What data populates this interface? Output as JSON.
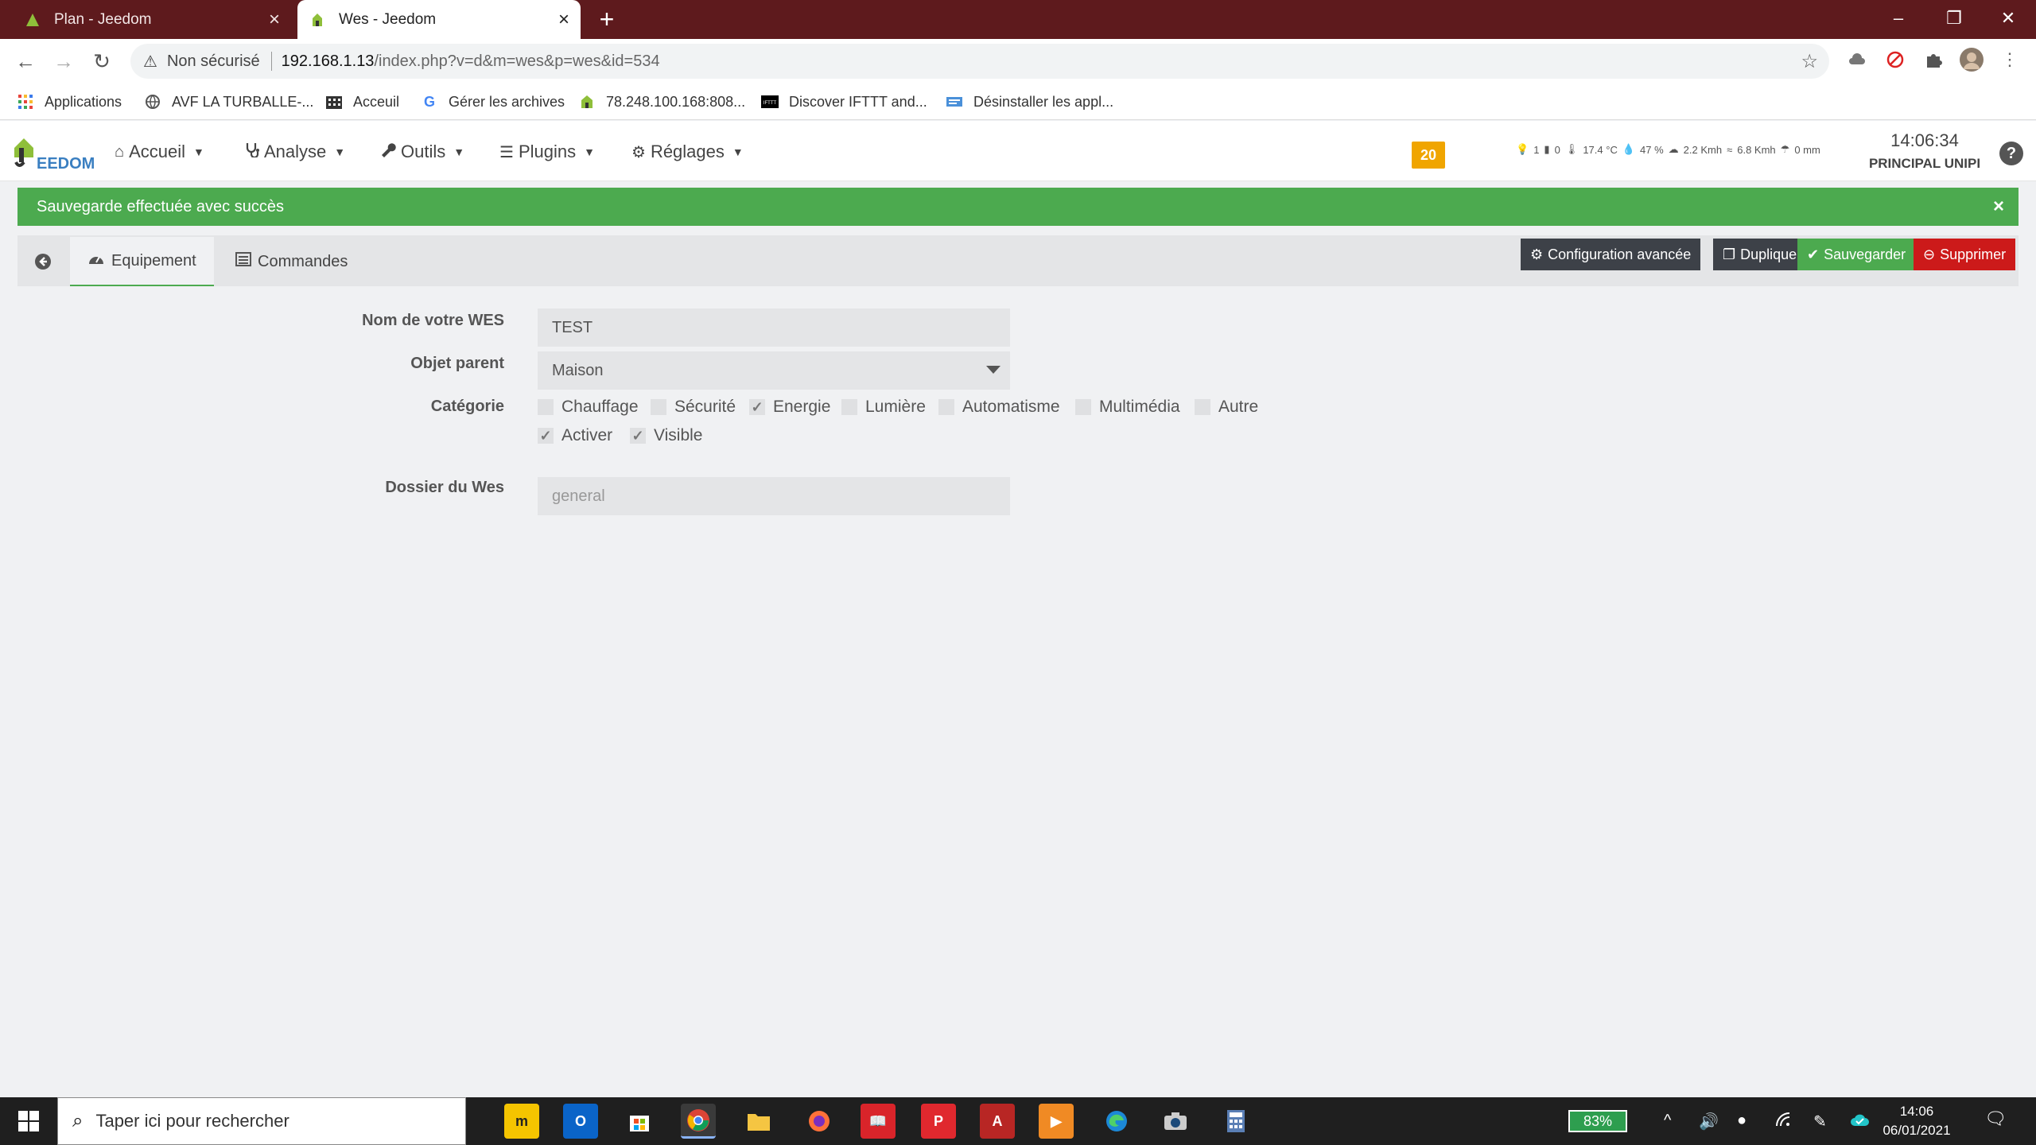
{
  "browser": {
    "tabs": [
      {
        "title": "Plan - Jeedom",
        "active": false
      },
      {
        "title": "Wes - Jeedom",
        "active": true
      }
    ],
    "url_security": "Non sécurisé",
    "url_host": "192.168.1.13",
    "url_path": "/index.php?v=d&m=wes&p=wes&id=534",
    "bookmarks": [
      {
        "label": "Applications",
        "icon": "apps-grid-icon"
      },
      {
        "label": "AVF LA TURBALLE-...",
        "icon": "globe-icon"
      },
      {
        "label": "Acceuil",
        "icon": "building-icon"
      },
      {
        "label": "Gérer les archives",
        "icon": "google-icon"
      },
      {
        "label": "78.248.100.168:808...",
        "icon": "jeedom-icon"
      },
      {
        "label": "Discover IFTTT and...",
        "icon": "ifttt-icon"
      },
      {
        "label": "Désinstaller les appl...",
        "icon": "uninstall-icon"
      }
    ]
  },
  "jeedom": {
    "menu": [
      {
        "label": "Accueil",
        "icon": "home-icon"
      },
      {
        "label": "Analyse",
        "icon": "stethoscope-icon"
      },
      {
        "label": "Outils",
        "icon": "wrench-icon"
      },
      {
        "label": "Plugins",
        "icon": "list-icon"
      },
      {
        "label": "Réglages",
        "icon": "gear-icon"
      }
    ],
    "notification_count": "20",
    "weather": {
      "lights": "1",
      "doors": "0",
      "temperature": "17.4 °C",
      "humidity": "47 %",
      "wind": "2.2 Kmh",
      "gust": "6.8 Kmh",
      "rain": "0 mm"
    },
    "time": "14:06:34",
    "hostname": "PRINCIPAL UNIPI"
  },
  "alert": {
    "message": "Sauvegarde effectuée avec succès",
    "close": "×"
  },
  "panel": {
    "tabs": {
      "equipment": "Equipement",
      "commands": "Commandes"
    },
    "actions": {
      "advanced": "Configuration avancée",
      "duplicate": "Dupliquer",
      "save": "Sauvegarder",
      "delete": "Supprimer"
    },
    "form": {
      "name_label": "Nom de votre WES",
      "name_value": "TEST",
      "parent_label": "Objet parent",
      "parent_value": "Maison",
      "category_label": "Catégorie",
      "categories": [
        {
          "label": "Chauffage",
          "checked": false
        },
        {
          "label": "Sécurité",
          "checked": false
        },
        {
          "label": "Energie",
          "checked": true
        },
        {
          "label": "Lumière",
          "checked": false
        },
        {
          "label": "Automatisme",
          "checked": false
        },
        {
          "label": "Multimédia",
          "checked": false
        },
        {
          "label": "Autre",
          "checked": false
        }
      ],
      "enable_label": "Activer",
      "enable_checked": true,
      "visible_label": "Visible",
      "visible_checked": true,
      "folder_label": "Dossier du Wes",
      "folder_placeholder": "general"
    }
  },
  "taskbar": {
    "search_placeholder": "Taper ici pour rechercher",
    "battery": "83%",
    "time": "14:06",
    "date": "06/01/2021"
  },
  "colors": {
    "chrome_frame": "#5e1a1d",
    "success": "#4caa4f",
    "danger": "#cc1a1a",
    "dark_button": "#3d4148",
    "notification": "#f0a500"
  }
}
